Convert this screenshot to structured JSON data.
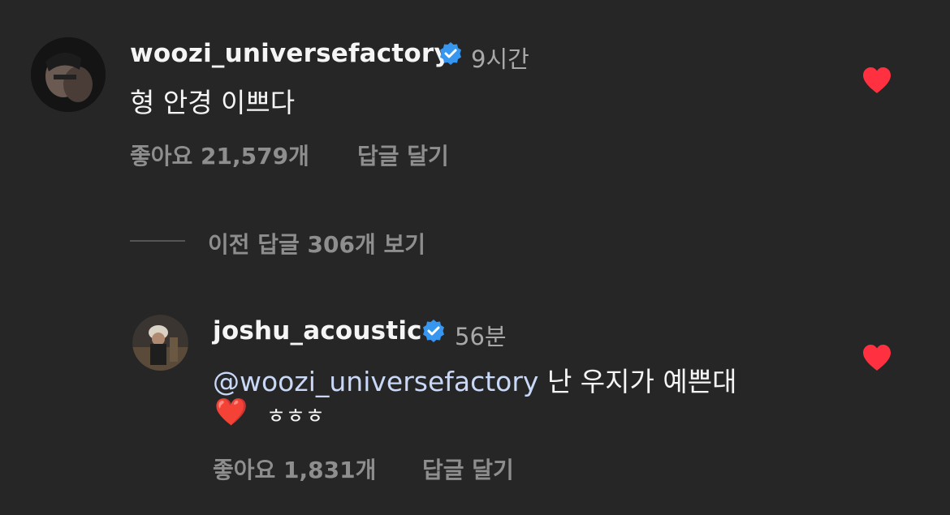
{
  "comments": [
    {
      "username": "woozi_universefactory",
      "time": "9시간",
      "text": "형 안경 이쁘다",
      "likes": "좋아요 21,579개",
      "reply": "답글 달기",
      "liked": true
    },
    {
      "username": "joshu_acoustic",
      "time": "56분",
      "mention": "@woozi_universefactory",
      "text": " 난 우지가 예쁜대",
      "emoji": "❤️",
      "text2": "ㅎㅎㅎ",
      "likes": "좋아요 1,831개",
      "reply": "답글 달기",
      "liked": true
    }
  ],
  "view_replies": "이전 답글 306개 보기",
  "colors": {
    "background": "#262626",
    "verified": "#3797f0",
    "heart": "#ff3040",
    "muted": "#a8a8a8",
    "mention": "#c9d8f7"
  }
}
